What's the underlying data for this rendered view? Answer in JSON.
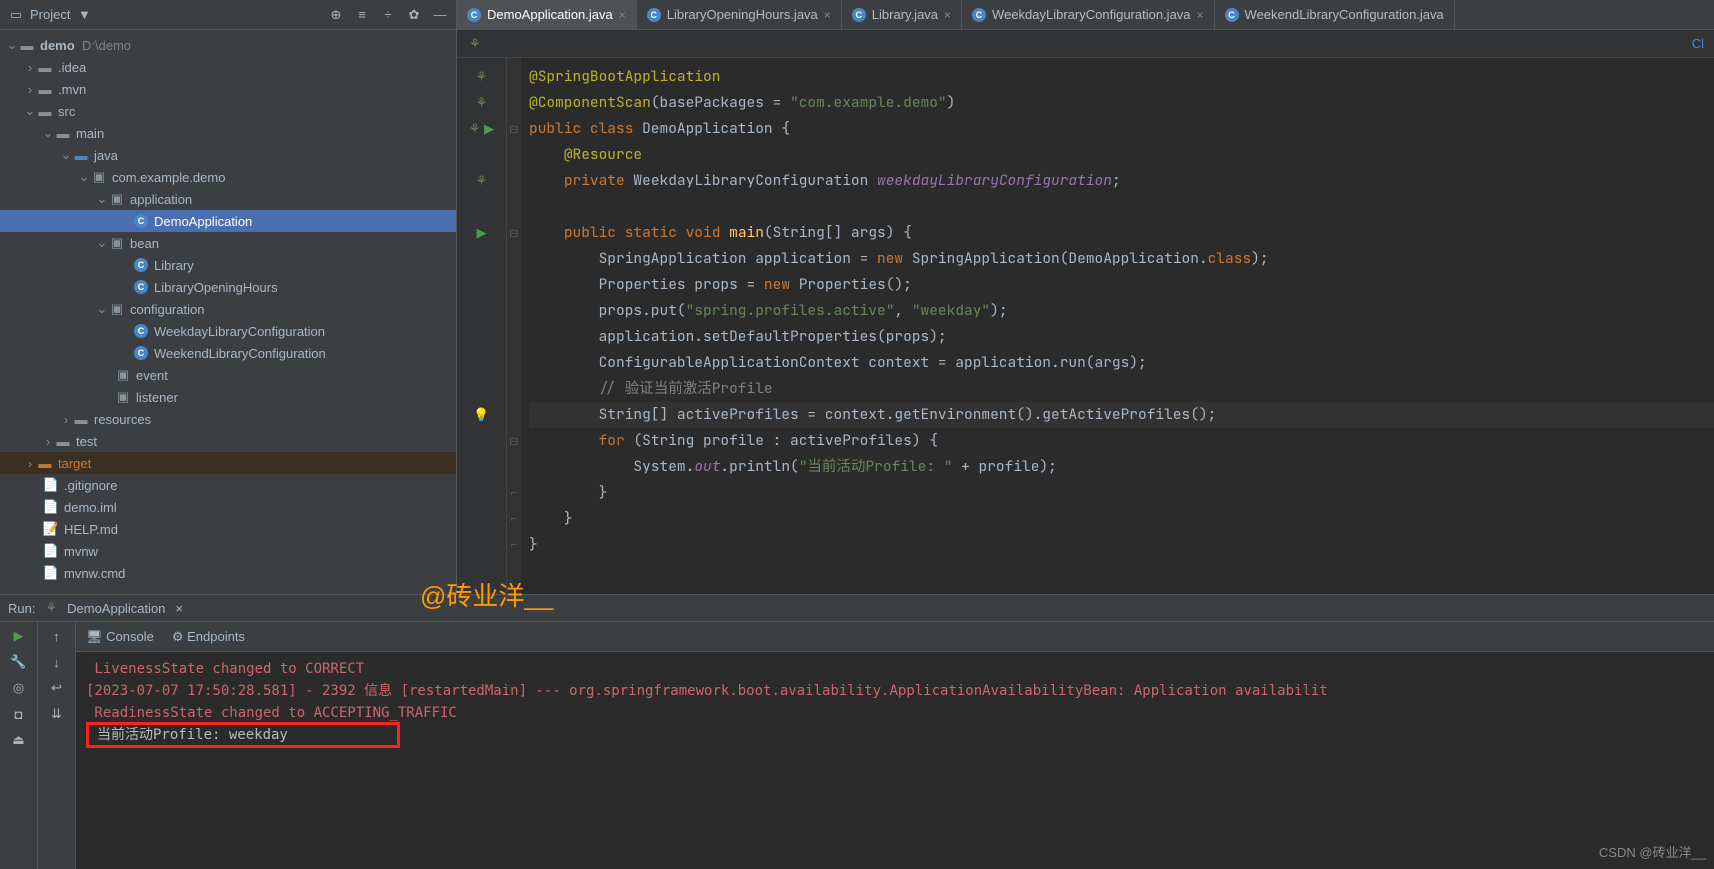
{
  "sidebar": {
    "title": "Project",
    "root": {
      "name": "demo",
      "path": "D:\\demo"
    },
    "items": [
      ".idea",
      ".mvn",
      "src",
      "main",
      "java",
      "com.example.demo",
      "application",
      "DemoApplication",
      "bean",
      "Library",
      "LibraryOpeningHours",
      "configuration",
      "WeekdayLibraryConfiguration",
      "WeekendLibraryConfiguration",
      "event",
      "listener",
      "resources",
      "test",
      "target",
      ".gitignore",
      "demo.iml",
      "HELP.md",
      "mvnw",
      "mvnw.cmd"
    ]
  },
  "tabs": [
    {
      "label": "DemoApplication.java",
      "active": true
    },
    {
      "label": "LibraryOpeningHours.java",
      "active": false
    },
    {
      "label": "Library.java",
      "active": false
    },
    {
      "label": "WeekdayLibraryConfiguration.java",
      "active": false
    },
    {
      "label": "WeekendLibraryConfiguration.java",
      "active": false
    }
  ],
  "breadcrumb_cl": "Cl",
  "code": {
    "l1_anno": "@SpringBootApplication",
    "l2_a": "@ComponentScan",
    "l2_b": "(basePackages = ",
    "l2_c": "\"com.example.demo\"",
    "l2_d": ")",
    "l3_a": "public class ",
    "l3_b": "DemoApplication",
    "l3_c": " {",
    "l4_anno": "@Resource",
    "l5_a": "private ",
    "l5_b": "WeekdayLibraryConfiguration ",
    "l5_c": "weekdayLibraryConfiguration",
    "l5_d": ";",
    "l7_a": "public static void ",
    "l7_b": "main",
    "l7_c": "(String[] args) {",
    "l8_a": "SpringApplication application = ",
    "l8_b": "new ",
    "l8_c": "SpringApplication(DemoApplication.",
    "l8_d": "class",
    "l8_e": ");",
    "l9_a": "Properties props = ",
    "l9_b": "new ",
    "l9_c": "Properties();",
    "l10_a": "props.put(",
    "l10_b": "\"spring.profiles.active\"",
    "l10_c": ", ",
    "l10_d": "\"weekday\"",
    "l10_e": ");",
    "l11": "application.setDefaultProperties(props);",
    "l12": "ConfigurableApplicationContext context = application.run(args);",
    "l13": "// 验证当前激活Profile",
    "l14": "String[] activeProfiles = context.getEnvironment().getActiveProfiles();",
    "l15_a": "for ",
    "l15_b": "(String profile : activeProfiles) {",
    "l16_a": "System.",
    "l16_b": "out",
    "l16_c": ".println(",
    "l16_d": "\"当前活动Profile: \"",
    "l16_e": " + profile);",
    "l17": "}",
    "l18": "}",
    "l19": "}"
  },
  "runPanel": {
    "runLabel": "Run:",
    "runConfig": "DemoApplication",
    "consoleTab": "Console",
    "endpointsTab": "Endpoints",
    "line1": " LivenessState changed to CORRECT",
    "line2": "[2023-07-07 17:50:28.581] - 2392 信息 [restartedMain] --- org.springframework.boot.availability.ApplicationAvailabilityBean: Application availabilit",
    "line3": " ReadinessState changed to ACCEPTING_TRAFFIC",
    "line4": "当前活动Profile: weekday"
  },
  "watermark": "@砖业洋__",
  "csdn": "CSDN @砖业洋__"
}
